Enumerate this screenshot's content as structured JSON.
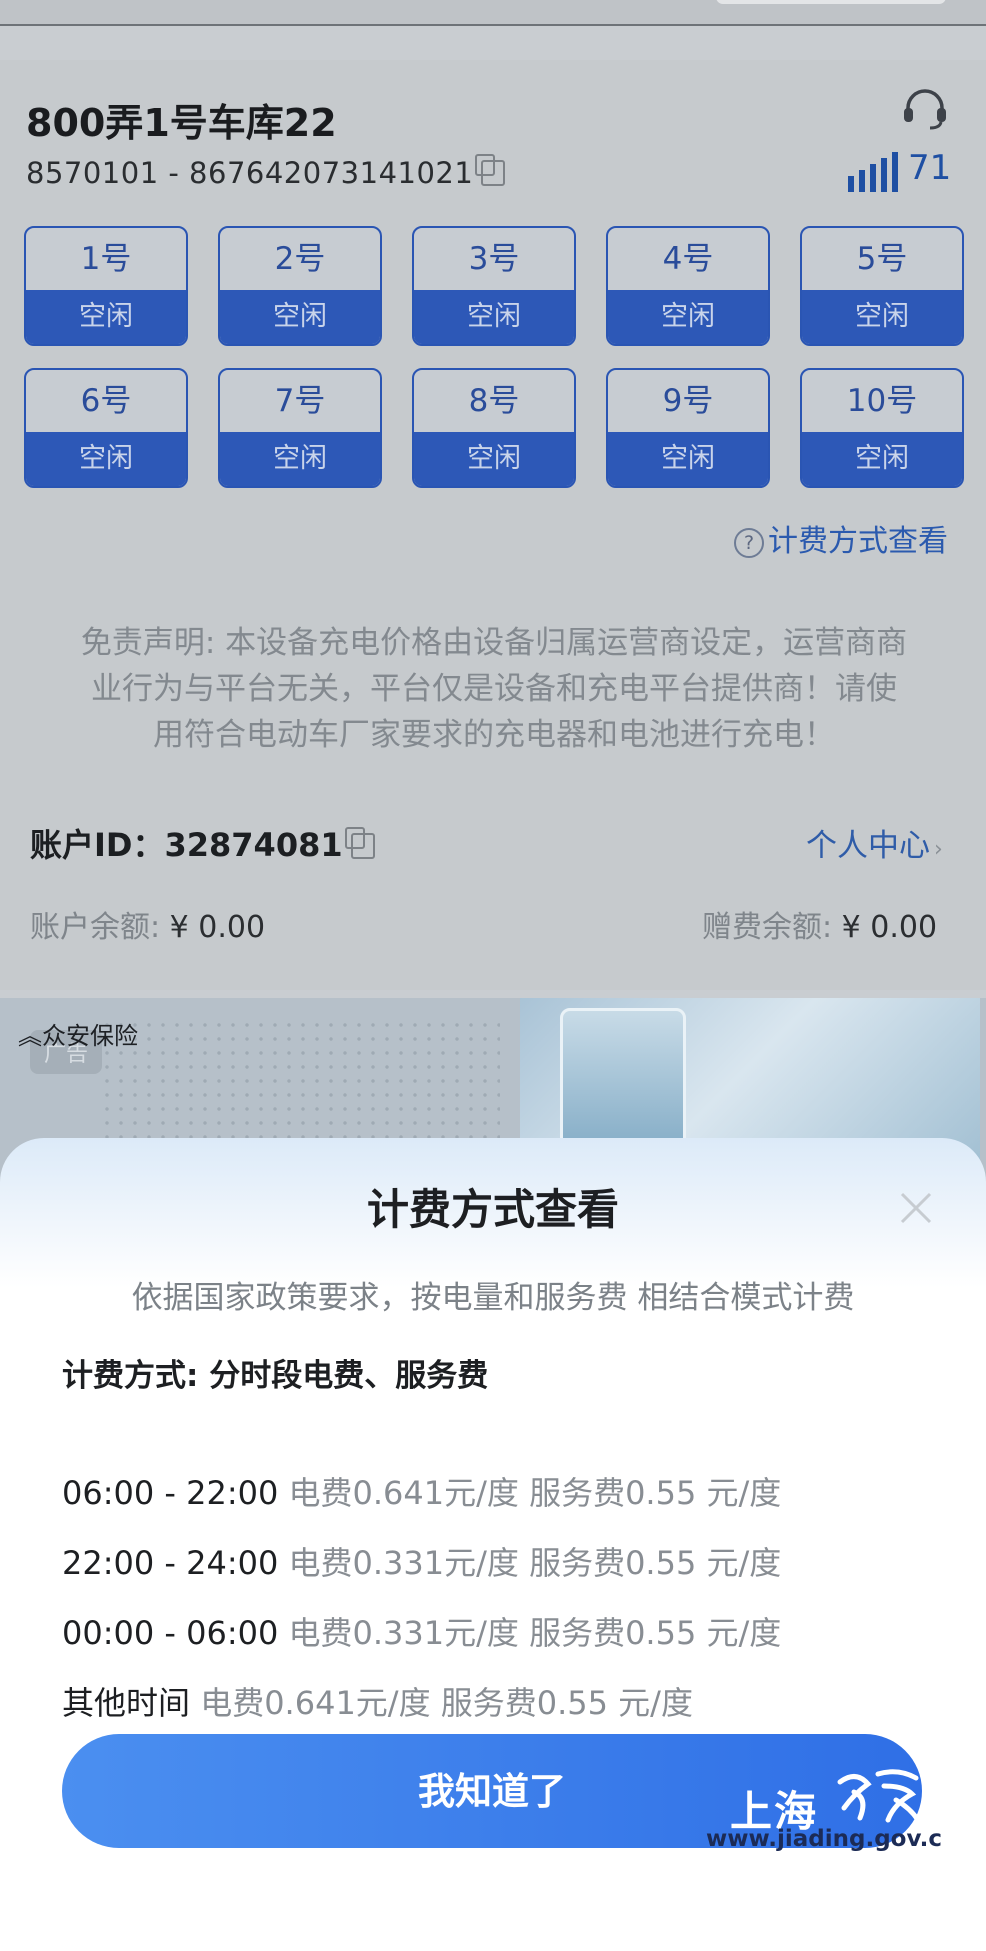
{
  "device": {
    "title": "800弄1号车库22",
    "code": "8570101 - 867642073141021",
    "signal": "71",
    "icons": [
      "headset-icon",
      "copy-icon",
      "signal-icon"
    ]
  },
  "ports": [
    {
      "num": "1号",
      "status": "空闲"
    },
    {
      "num": "2号",
      "status": "空闲"
    },
    {
      "num": "3号",
      "status": "空闲"
    },
    {
      "num": "4号",
      "status": "空闲"
    },
    {
      "num": "5号",
      "status": "空闲"
    },
    {
      "num": "6号",
      "status": "空闲"
    },
    {
      "num": "7号",
      "status": "空闲"
    },
    {
      "num": "8号",
      "status": "空闲"
    },
    {
      "num": "9号",
      "status": "空闲"
    },
    {
      "num": "10号",
      "status": "空闲"
    }
  ],
  "billing_link": "计费方式查看",
  "disclaimer": {
    "line1": "免责声明: 本设备充电价格由设备归属运营商设定，运营商商",
    "line2": "业行为与平台无关，平台仅是设备和充电平台提供商！请使",
    "line3": "用符合电动车厂家要求的充电器和电池进行充电！"
  },
  "account": {
    "label": "账户ID：",
    "id": "32874081",
    "personal_center": "个人中心",
    "balance_label": "账户余额:",
    "balance_value": "¥ 0.00",
    "gift_label": "赠费余额:",
    "gift_value": "¥ 0.00"
  },
  "ad": {
    "label": "众安保险",
    "tag": "广告"
  },
  "modal": {
    "title": "计费方式查看",
    "policy": "依据国家政策要求，按电量和服务费 相结合模式计费",
    "mode": "计费方式: 分时段电费、服务费",
    "rates": [
      {
        "time": "06:00 - 22:00",
        "desc": "电费0.641元/度 服务费0.55 元/度"
      },
      {
        "time": "22:00 - 24:00",
        "desc": "电费0.331元/度 服务费0.55 元/度"
      },
      {
        "time": "00:00 - 06:00",
        "desc": "电费0.331元/度 服务费0.55 元/度"
      },
      {
        "time": "其他时间",
        "desc": "电费0.641元/度 服务费0.55 元/度"
      }
    ],
    "confirm": "我知道了"
  },
  "watermark": {
    "city": "上海",
    "url": "www.jiading.gov.c"
  },
  "colors": {
    "port_blue": "#2d58b7",
    "button_blue": "#3a7cec",
    "link_blue": "#2b5aae"
  }
}
